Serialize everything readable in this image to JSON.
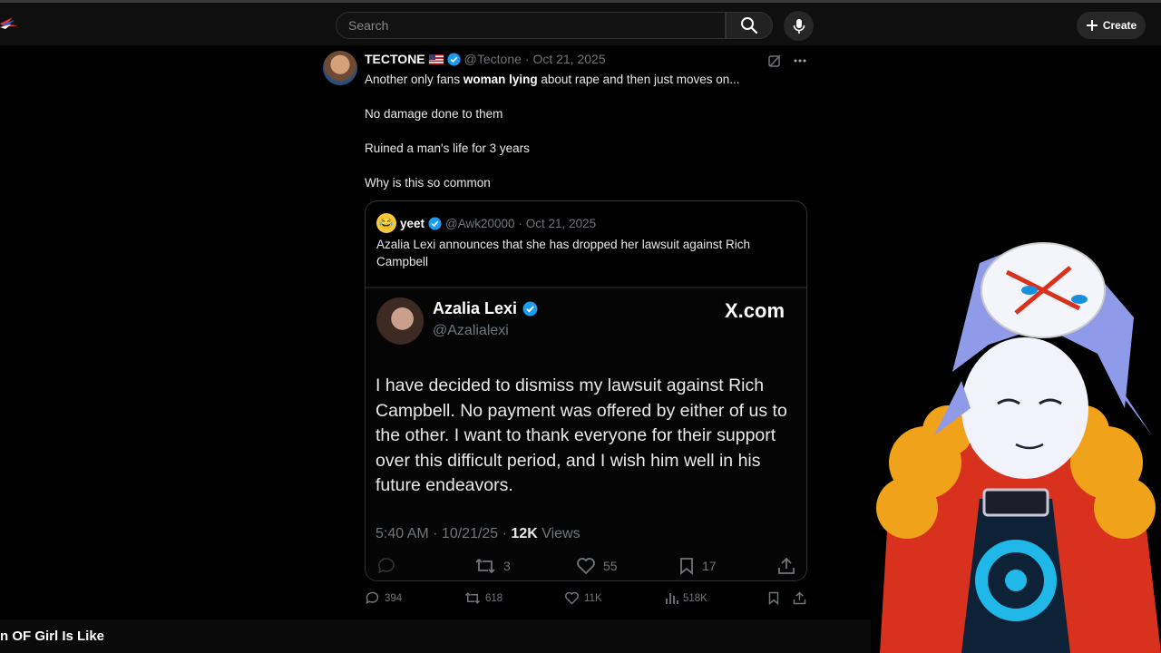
{
  "header": {
    "search_placeholder": "Search",
    "create_label": "Create"
  },
  "tweet": {
    "name": "TECTONE",
    "handle": "@Tectone",
    "date": "· Oct 21, 2025",
    "line1_pre": "Another only fans ",
    "line1_bold": "woman lying",
    "line1_post": " about rape and then just moves on...",
    "line2": "No damage done to them",
    "line3": "Ruined a man's life for 3 years",
    "line4": "Why is this so common",
    "quote": {
      "name": "yeet",
      "handle": "@Awk20000",
      "date": "· Oct 21, 2025",
      "text": "Azalia Lexi announces that she has dropped her lawsuit against Rich Campbell",
      "screenshot": {
        "name": "Azalia Lexi",
        "handle": "@Azalialexi",
        "brand": "X.com",
        "text": "I have decided to dismiss my lawsuit against Rich Campbell. No payment was offered by either of us to the other. I want to thank everyone for their support over this difficult period, and I wish him well in his future endeavors.",
        "timestamp": "5:40 AM · 10/21/25 · ",
        "views_count": "12K",
        "views_label": " Views",
        "retweets": "3",
        "likes": "55",
        "bookmarks": "17"
      }
    },
    "replies": "394",
    "retweets": "618",
    "likes": "11K",
    "views": "518K"
  },
  "video_title": "n OF Girl Is Like",
  "colors": {
    "verified": "#1d9bf0",
    "background": "#000000",
    "muted": "#71767b"
  }
}
